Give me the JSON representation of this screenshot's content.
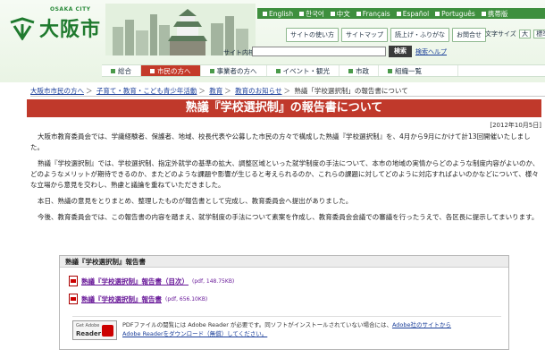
{
  "header": {
    "logo_small": "OSAKA CITY",
    "logo_name": "大阪市",
    "languages": [
      "English",
      "한국어",
      "中文",
      "Français",
      "Español",
      "Português",
      "携帯版"
    ],
    "utility_links": [
      "サイトの使い方",
      "サイトマップ",
      "読上げ・ふりがな",
      "お問合せ"
    ],
    "font_size_label": "文字サイズ",
    "font_sizes": [
      "大",
      "標準"
    ],
    "search_label": "サイト内検索",
    "search_button": "検索",
    "search_help": "検索ヘルプ"
  },
  "nav": {
    "items": [
      "総合",
      "市民の方へ",
      "事業者の方へ",
      "イベント・観光",
      "市政",
      "組織一覧"
    ],
    "active_index": 1
  },
  "breadcrumb": {
    "items": [
      "大阪市市民の方へ",
      "子育て・教育・こども青少年活動",
      "教育",
      "教育のお知らせ",
      "熟議「学校選択制」の報告書について"
    ]
  },
  "page": {
    "title": "熟議『学校選択制』の報告書について",
    "date": "[2012年10月5日]",
    "paragraphs": [
      "大阪市教育委員会では、学識経験者、保護者、地域、校長代表や公募した市民の方々で構成した熟議『学校選択制』を、4月から9月にかけて計13回開催いたしました。",
      "熟議『学校選択制』では、学校選択制、指定外就学の基準の拡大、調整区域といった就学制度の手法について、本市の地域の実情からどのような制度内容がよいのか、どのようなメリットが期待できるのか、またどのような課題や影響が生じると考えられるのか、これらの課題に対してどのように対応すればよいのかなどについて、様々な立場から意見を交わし、熟慮と議論を重ねていただきました。",
      "本日、熟議の意見をとりまとめ、整理したものが報告書として完成し、教育委員会へ提出がありました。",
      "今後、教育委員会では、この報告書の内容を踏まえ、就学制度の手法について素案を作成し、教育委員会会議での審議を行ったうえで、各区長に提示してまいります。"
    ]
  },
  "report": {
    "heading": "熟議『学校選択制』報告書",
    "files": [
      {
        "title": "熟議『学校選択制』報告書（目次）",
        "meta": "(pdf, 148.75KB)"
      },
      {
        "title": "熟議『学校選択制』報告書",
        "meta": "(pdf, 656.10KB)"
      }
    ],
    "adobe_badge_top": "Get Adobe",
    "adobe_badge_name": "Reader",
    "adobe_text_line1": "PDFファイルの閲覧には Adobe Reader が必要です。同ソフトがインストールされていない場合には、",
    "adobe_text_link1": "Adobe社のサイトから",
    "adobe_text_link2": "Adobe Readerをダウンロード（無償）してください。"
  }
}
